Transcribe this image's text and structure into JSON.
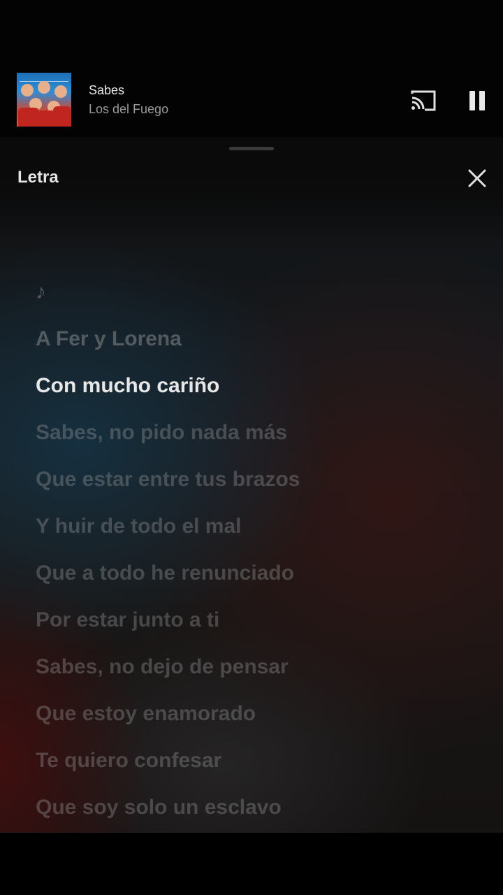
{
  "mini_player": {
    "title": "Sabes",
    "artist": "Los del Fuego",
    "album_art_label": "Los del Fuego"
  },
  "sheet": {
    "title": "Letra"
  },
  "lyrics": [
    {
      "text": "♪",
      "state": "passed"
    },
    {
      "text": "A Fer y Lorena",
      "state": "passed"
    },
    {
      "text": "Con mucho cariño",
      "state": "active"
    },
    {
      "text": "Sabes, no pido nada más",
      "state": "upcoming"
    },
    {
      "text": "Que estar entre tus brazos",
      "state": "upcoming"
    },
    {
      "text": "Y huir de todo el mal",
      "state": "upcoming"
    },
    {
      "text": "Que a todo he renunciado",
      "state": "upcoming"
    },
    {
      "text": "Por estar junto a ti",
      "state": "upcoming"
    },
    {
      "text": "Sabes, no dejo de pensar",
      "state": "upcoming"
    },
    {
      "text": "Que estoy enamorado",
      "state": "upcoming"
    },
    {
      "text": "Te quiero confesar",
      "state": "upcoming"
    },
    {
      "text": "Que soy solo un esclavo",
      "state": "upcoming"
    }
  ],
  "icons": {
    "cast": "cast-icon",
    "pause": "pause-icon",
    "close": "close-icon"
  }
}
